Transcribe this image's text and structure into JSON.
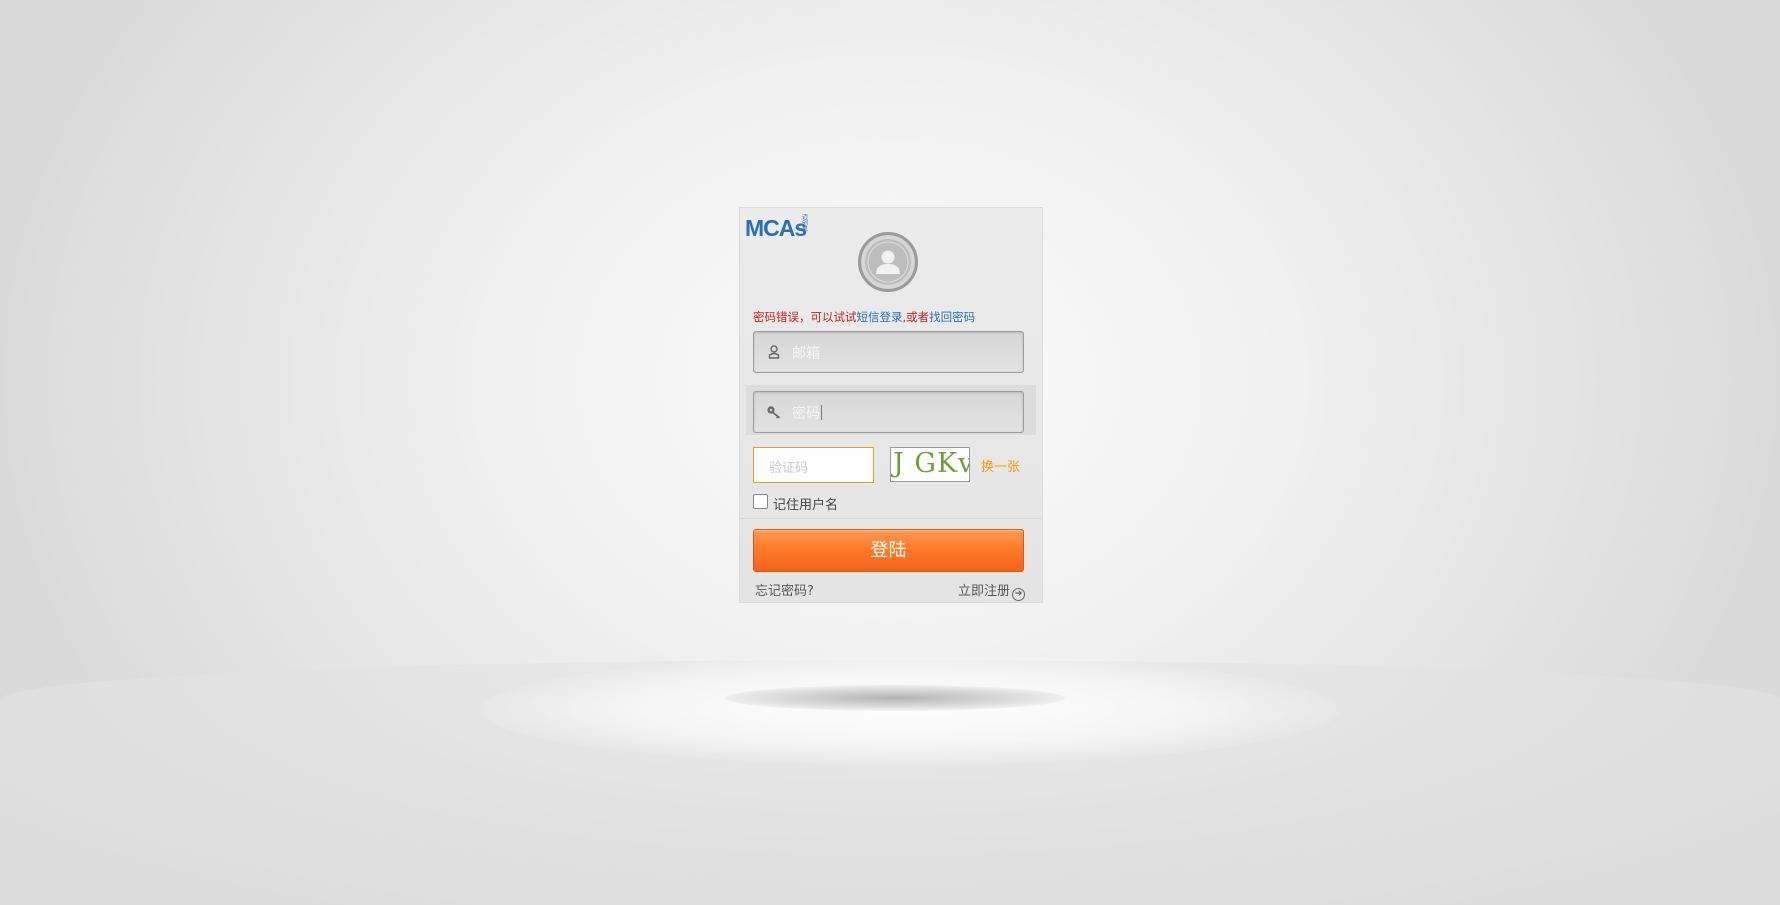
{
  "logo": {
    "text": "MCAs",
    "sub": "迈创思"
  },
  "error": {
    "prefix": "密码错误，可以试试",
    "sms_link": "短信登录",
    "middle": ",或者",
    "recover_link": "找回密码"
  },
  "email_field": {
    "placeholder": "邮箱",
    "icon": "user-icon"
  },
  "password_field": {
    "placeholder": "密码",
    "icon": "key-icon"
  },
  "captcha": {
    "placeholder": "验证码",
    "image_text": "J GKv",
    "refresh_label": "换一张"
  },
  "remember": {
    "label": "记住用户名",
    "checked": false
  },
  "login_button": {
    "label": "登陆"
  },
  "links": {
    "forgot": "忘记密码?",
    "register": "立即注册"
  },
  "colors": {
    "brand": "#2b6fb8",
    "accent": "#ff7b2a",
    "error": "#cc1f1f",
    "captcha_border": "#f39c12"
  }
}
